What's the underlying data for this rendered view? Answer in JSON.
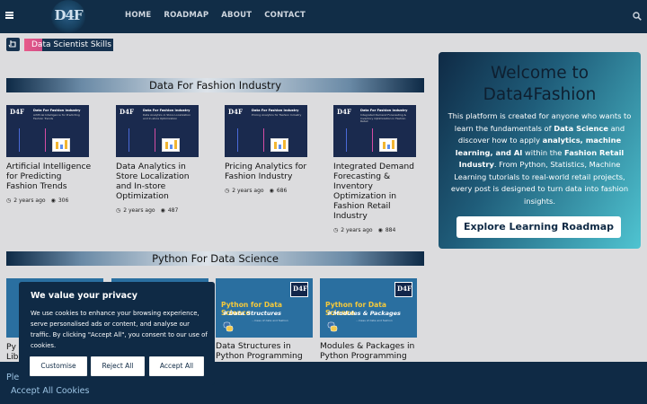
{
  "nav": {
    "logo": "D4F",
    "links": [
      "HOME",
      "ROADMAP",
      "ABOUT",
      "CONTACT"
    ]
  },
  "skill_tag": "Data Scientist Skills",
  "sections": [
    {
      "title": "Data For Fashion Industry",
      "cards": [
        {
          "thumb_title": "Data For Fashion Industry",
          "thumb_sub": "Artificial Intelligence for Predicting Fashion Trends",
          "title": "Artificial Intelligence for Predicting Fashion Trends",
          "date": "2 years ago",
          "views": "306"
        },
        {
          "thumb_title": "Data For Fashion Industry",
          "thumb_sub": "Data Analytics in Store Localization and In-store Optimization",
          "title": "Data Analytics in Store Localization and In-store Optimization",
          "date": "2 years ago",
          "views": "487"
        },
        {
          "thumb_title": "Data For Fashion Industry",
          "thumb_sub": "Pricing Analytics for Fashion Industry",
          "title": "Pricing Analytics for Fashion Industry",
          "date": "2 years ago",
          "views": "686"
        },
        {
          "thumb_title": "Data For Fashion Industry",
          "thumb_sub": "Integrated Demand Forecasting & Inventory Optimization in Fashion Retail",
          "title": "Integrated Demand Forecasting & Inventory Optimization in Fashion Retail Industry",
          "date": "2 years ago",
          "views": "884"
        }
      ]
    },
    {
      "title": "Python For Data Science",
      "cards": [
        {
          "thumb_title": "Python for Data Science",
          "thumb_sub": "# Data Structures",
          "thumb_mini": "...mess of data and fashion",
          "title": "Data Structures in Python Programming"
        },
        {
          "thumb_title": "Python for Data Science",
          "thumb_sub": "# Modules & Packages",
          "thumb_mini": "...mess of data and fashion",
          "title": "Modules & Packages in Python Programming"
        }
      ],
      "partial_titles": [
        "Py",
        "Lib"
      ]
    }
  ],
  "welcome": {
    "title": "Welcome to Data4Fashion",
    "body_1": "This platform is created for anyone who wants to learn the fundamentals of ",
    "b1": "Data Science",
    "body_2": " and discover how to apply ",
    "b2": "analytics, machine learning, and AI",
    "body_3": " within the ",
    "b3": "Fashion Retail Industry",
    "body_4": ". From Python, Statistics, Machine Learning tutorials to real-world retail projects, every post is designed to turn data into fashion insights.",
    "button": "Explore Learning Roadmap"
  },
  "cookie_bar": {
    "text": "Ple",
    "accept_all": "Accept All Cookies"
  },
  "consent": {
    "title": "We value your privacy",
    "body": "We use cookies to enhance your browsing experience, serve personalised ads or content, and analyse our traffic. By clicking \"Accept All\", you consent to our use of cookies.",
    "buttons": [
      "Customise",
      "Reject All",
      "Accept All"
    ]
  },
  "colors": {
    "navbar": "#112d47",
    "accent_pink": "#e85b8a",
    "python_blue": "#2a6fa0"
  }
}
